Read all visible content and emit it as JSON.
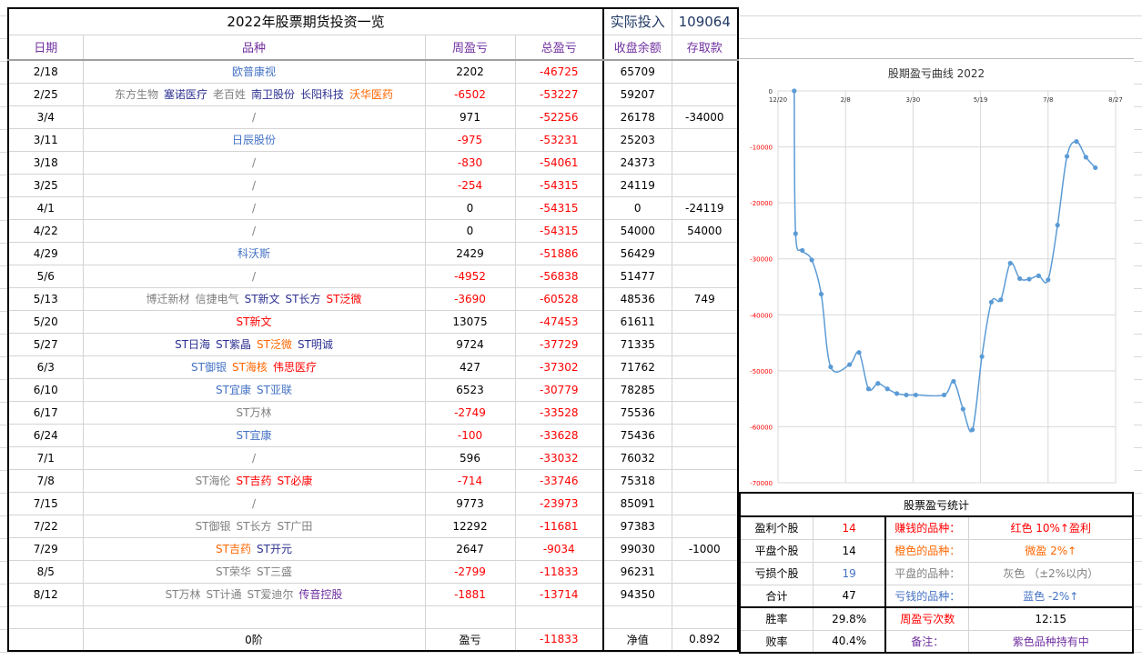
{
  "title": "2022年股票期货投资一览",
  "invest_label": "实际投入",
  "invest_value": "109064",
  "headers": [
    "日期",
    "品种",
    "周盈亏",
    "总盈亏",
    "收盘余额",
    "存取款"
  ],
  "colors": {
    "gray": "#808080",
    "navy": "#2e3192",
    "blue": "#4472c4",
    "orange": "#ff6600",
    "red": "#ff0000",
    "purple": "#7030a0",
    "line": "#5b9bd5"
  },
  "rows": [
    {
      "date": "2/18",
      "items": [
        {
          "t": "欧普康视",
          "c": "blue"
        }
      ],
      "week": "2202",
      "total": "-46725",
      "balance": "65709",
      "flow": ""
    },
    {
      "date": "2/25",
      "items": [
        {
          "t": "东方生物",
          "c": "gray"
        },
        {
          "t": "塞诺医疗",
          "c": "navy"
        },
        {
          "t": "老百姓",
          "c": "gray"
        },
        {
          "t": "南卫股份",
          "c": "navy"
        },
        {
          "t": "长阳科技",
          "c": "navy"
        },
        {
          "t": "沃华医药",
          "c": "orange"
        }
      ],
      "week": "-6502",
      "total": "-53227",
      "balance": "59207",
      "flow": ""
    },
    {
      "date": "3/4",
      "items": [
        {
          "t": "/",
          "c": "gray"
        }
      ],
      "week": "971",
      "total": "-52256",
      "balance": "26178",
      "flow": "-34000"
    },
    {
      "date": "3/11",
      "items": [
        {
          "t": "日辰股份",
          "c": "blue"
        }
      ],
      "week": "-975",
      "total": "-53231",
      "balance": "25203",
      "flow": ""
    },
    {
      "date": "3/18",
      "items": [
        {
          "t": "/",
          "c": "gray"
        }
      ],
      "week": "-830",
      "total": "-54061",
      "balance": "24373",
      "flow": ""
    },
    {
      "date": "3/25",
      "items": [
        {
          "t": "/",
          "c": "gray"
        }
      ],
      "week": "-254",
      "total": "-54315",
      "balance": "24119",
      "flow": ""
    },
    {
      "date": "4/1",
      "items": [
        {
          "t": "/",
          "c": "gray"
        }
      ],
      "week": "0",
      "total": "-54315",
      "balance": "0",
      "flow": "-24119"
    },
    {
      "date": "4/22",
      "items": [
        {
          "t": "/",
          "c": "gray"
        }
      ],
      "week": "0",
      "total": "-54315",
      "balance": "54000",
      "flow": "54000"
    },
    {
      "date": "4/29",
      "items": [
        {
          "t": "科沃斯",
          "c": "blue"
        }
      ],
      "week": "2429",
      "total": "-51886",
      "balance": "56429",
      "flow": ""
    },
    {
      "date": "5/6",
      "items": [
        {
          "t": "/",
          "c": "gray"
        }
      ],
      "week": "-4952",
      "total": "-56838",
      "balance": "51477",
      "flow": ""
    },
    {
      "date": "5/13",
      "items": [
        {
          "t": "博迁新材",
          "c": "gray"
        },
        {
          "t": "信捷电气",
          "c": "gray"
        },
        {
          "t": "ST新文",
          "c": "navy"
        },
        {
          "t": "ST长方",
          "c": "navy"
        },
        {
          "t": "ST泛微",
          "c": "red"
        }
      ],
      "week": "-3690",
      "total": "-60528",
      "balance": "48536",
      "flow": "749"
    },
    {
      "date": "5/20",
      "items": [
        {
          "t": "ST新文",
          "c": "red"
        }
      ],
      "week": "13075",
      "total": "-47453",
      "balance": "61611",
      "flow": ""
    },
    {
      "date": "5/27",
      "items": [
        {
          "t": "ST日海",
          "c": "navy"
        },
        {
          "t": "ST紫晶",
          "c": "navy"
        },
        {
          "t": "ST泛微",
          "c": "orange"
        },
        {
          "t": "ST明诚",
          "c": "navy"
        }
      ],
      "week": "9724",
      "total": "-37729",
      "balance": "71335",
      "flow": ""
    },
    {
      "date": "6/3",
      "items": [
        {
          "t": "ST御银",
          "c": "blue"
        },
        {
          "t": "ST海核",
          "c": "orange"
        },
        {
          "t": "伟思医疗",
          "c": "red"
        }
      ],
      "week": "427",
      "total": "-37302",
      "balance": "71762",
      "flow": ""
    },
    {
      "date": "6/10",
      "items": [
        {
          "t": "ST宜康",
          "c": "blue"
        },
        {
          "t": "ST亚联",
          "c": "blue"
        }
      ],
      "week": "6523",
      "total": "-30779",
      "balance": "78285",
      "flow": ""
    },
    {
      "date": "6/17",
      "items": [
        {
          "t": "ST万林",
          "c": "gray"
        }
      ],
      "week": "-2749",
      "total": "-33528",
      "balance": "75536",
      "flow": ""
    },
    {
      "date": "6/24",
      "items": [
        {
          "t": "ST宜康",
          "c": "blue"
        }
      ],
      "week": "-100",
      "total": "-33628",
      "balance": "75436",
      "flow": ""
    },
    {
      "date": "7/1",
      "items": [
        {
          "t": "/",
          "c": "gray"
        }
      ],
      "week": "596",
      "total": "-33032",
      "balance": "76032",
      "flow": ""
    },
    {
      "date": "7/8",
      "items": [
        {
          "t": "ST海伦",
          "c": "gray"
        },
        {
          "t": "ST吉药",
          "c": "red"
        },
        {
          "t": "ST必康",
          "c": "red"
        }
      ],
      "week": "-714",
      "total": "-33746",
      "balance": "75318",
      "flow": ""
    },
    {
      "date": "7/15",
      "items": [
        {
          "t": "/",
          "c": "gray"
        }
      ],
      "week": "9773",
      "total": "-23973",
      "balance": "85091",
      "flow": ""
    },
    {
      "date": "7/22",
      "items": [
        {
          "t": "ST御银",
          "c": "gray"
        },
        {
          "t": "ST长方",
          "c": "gray"
        },
        {
          "t": "ST广田",
          "c": "gray"
        }
      ],
      "week": "12292",
      "total": "-11681",
      "balance": "97383",
      "flow": ""
    },
    {
      "date": "7/29",
      "items": [
        {
          "t": "ST吉药",
          "c": "orange"
        },
        {
          "t": "ST开元",
          "c": "navy"
        }
      ],
      "week": "2647",
      "total": "-9034",
      "balance": "99030",
      "flow": "-1000"
    },
    {
      "date": "8/5",
      "items": [
        {
          "t": "ST荣华",
          "c": "gray"
        },
        {
          "t": "ST三盛",
          "c": "gray"
        }
      ],
      "week": "-2799",
      "total": "-11833",
      "balance": "96231",
      "flow": ""
    },
    {
      "date": "8/12",
      "items": [
        {
          "t": "ST万林",
          "c": "gray"
        },
        {
          "t": "ST计通",
          "c": "gray"
        },
        {
          "t": "ST爱迪尔",
          "c": "gray"
        },
        {
          "t": "传音控股",
          "c": "purple"
        }
      ],
      "week": "-1881",
      "total": "-13714",
      "balance": "94350",
      "flow": ""
    }
  ],
  "summary": {
    "stage": "0阶",
    "pl_label": "盈亏",
    "pl_value": "-11833",
    "nav_label": "净值",
    "nav_value": "0.892"
  },
  "stats": {
    "title": "股票盈亏统计",
    "rows": [
      {
        "k": "盈利个股",
        "v": "14",
        "vc": "red",
        "k2": "赚钱的品种：",
        "k2c": "red",
        "v2": "红色 10%↑盈利",
        "v2c": "red"
      },
      {
        "k": "平盘个股",
        "v": "14",
        "vc": "",
        "k2": "橙色的品种：",
        "k2c": "orange",
        "v2": "微盈 2%↑",
        "v2c": "orange"
      },
      {
        "k": "亏损个股",
        "v": "19",
        "vc": "blue",
        "k2": "平盘的品种：",
        "k2c": "gray",
        "v2": "灰色 （±2%以内）",
        "v2c": "gray"
      },
      {
        "k": "合计",
        "v": "47",
        "vc": "",
        "k2": "亏钱的品种：",
        "k2c": "blue",
        "v2": "蓝色 -2%↑",
        "v2c": "blue"
      },
      {
        "k": "胜率",
        "v": "29.8%",
        "vc": "",
        "k2": "周盈亏次数",
        "k2c": "red",
        "v2": "12:15",
        "v2c": ""
      },
      {
        "k": "败率",
        "v": "40.4%",
        "vc": "",
        "k2": "备注：",
        "k2c": "purple",
        "v2": "紫色品种持有中",
        "v2c": "purple"
      }
    ]
  },
  "chart_data": {
    "type": "line",
    "title": "股期盈亏曲线 2022",
    "x_ticks": [
      "12/20",
      "2/8",
      "3/30",
      "5/19",
      "7/8",
      "8/27"
    ],
    "y_ticks": [
      "0",
      "-10000",
      "-20000",
      "-30000",
      "-40000",
      "-50000",
      "-60000",
      "-70000"
    ],
    "ylim": [
      -70000,
      0
    ],
    "xlim_days": [
      0,
      250
    ],
    "x_start": "12/20",
    "points": [
      {
        "x": "1/1",
        "d": 12,
        "y": 0
      },
      {
        "x": "1/2",
        "d": 13,
        "y": -25500
      },
      {
        "x": "1/7",
        "d": 18,
        "y": -28500
      },
      {
        "x": "1/14",
        "d": 25,
        "y": -30200
      },
      {
        "x": "1/21",
        "d": 32,
        "y": -36300
      },
      {
        "x": "1/28",
        "d": 39,
        "y": -49300
      },
      {
        "x": "2/11",
        "d": 53,
        "y": -48900
      },
      {
        "x": "2/18",
        "d": 60,
        "y": -46725
      },
      {
        "x": "2/25",
        "d": 67,
        "y": -53227
      },
      {
        "x": "3/4",
        "d": 74,
        "y": -52256
      },
      {
        "x": "3/11",
        "d": 81,
        "y": -53231
      },
      {
        "x": "3/18",
        "d": 88,
        "y": -54061
      },
      {
        "x": "3/25",
        "d": 95,
        "y": -54315
      },
      {
        "x": "4/1",
        "d": 102,
        "y": -54315
      },
      {
        "x": "4/22",
        "d": 123,
        "y": -54315
      },
      {
        "x": "4/29",
        "d": 130,
        "y": -51886
      },
      {
        "x": "5/6",
        "d": 137,
        "y": -56838
      },
      {
        "x": "5/13",
        "d": 144,
        "y": -60528
      },
      {
        "x": "5/20",
        "d": 151,
        "y": -47453
      },
      {
        "x": "5/27",
        "d": 158,
        "y": -37729
      },
      {
        "x": "6/3",
        "d": 165,
        "y": -37302
      },
      {
        "x": "6/10",
        "d": 172,
        "y": -30779
      },
      {
        "x": "6/17",
        "d": 179,
        "y": -33528
      },
      {
        "x": "6/24",
        "d": 186,
        "y": -33628
      },
      {
        "x": "7/1",
        "d": 193,
        "y": -33032
      },
      {
        "x": "7/8",
        "d": 200,
        "y": -33746
      },
      {
        "x": "7/15",
        "d": 207,
        "y": -23973
      },
      {
        "x": "7/22",
        "d": 214,
        "y": -11681
      },
      {
        "x": "7/29",
        "d": 221,
        "y": -9034
      },
      {
        "x": "8/5",
        "d": 228,
        "y": -11833
      },
      {
        "x": "8/12",
        "d": 235,
        "y": -13714
      }
    ]
  }
}
